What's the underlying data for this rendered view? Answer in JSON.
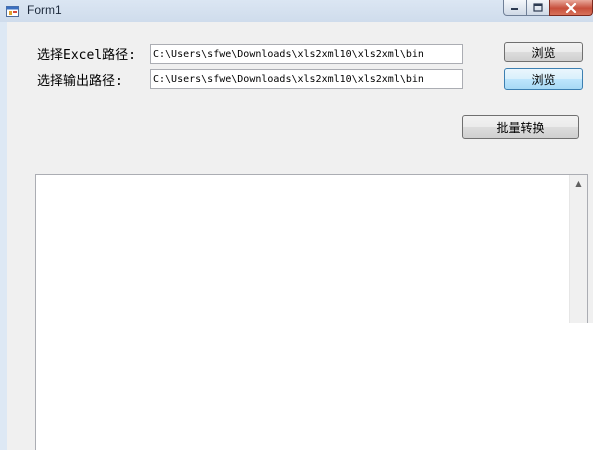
{
  "window": {
    "title": "Form1",
    "icon": "form-app-icon",
    "controls": {
      "minimize_icon": "minimize-icon",
      "maximize_icon": "maximize-icon",
      "close_icon": "close-icon"
    }
  },
  "form": {
    "excel_label": "选择Excel路径:",
    "excel_path": "C:\\Users\\sfwe\\Downloads\\xls2xml10\\xls2xml\\bin",
    "output_label": "选择输出路径:",
    "output_path": "C:\\Users\\sfwe\\Downloads\\xls2xml10\\xls2xml\\bin",
    "browse_excel_label": "浏览",
    "browse_output_label": "浏览",
    "batch_convert_label": "批量转换"
  },
  "output_area": {
    "text": ""
  },
  "colors": {
    "titlebar": "#dbe6f3",
    "client_bg": "#f0f0f0",
    "close_button": "#c74f3b",
    "focused_button": "#bee6fd"
  }
}
